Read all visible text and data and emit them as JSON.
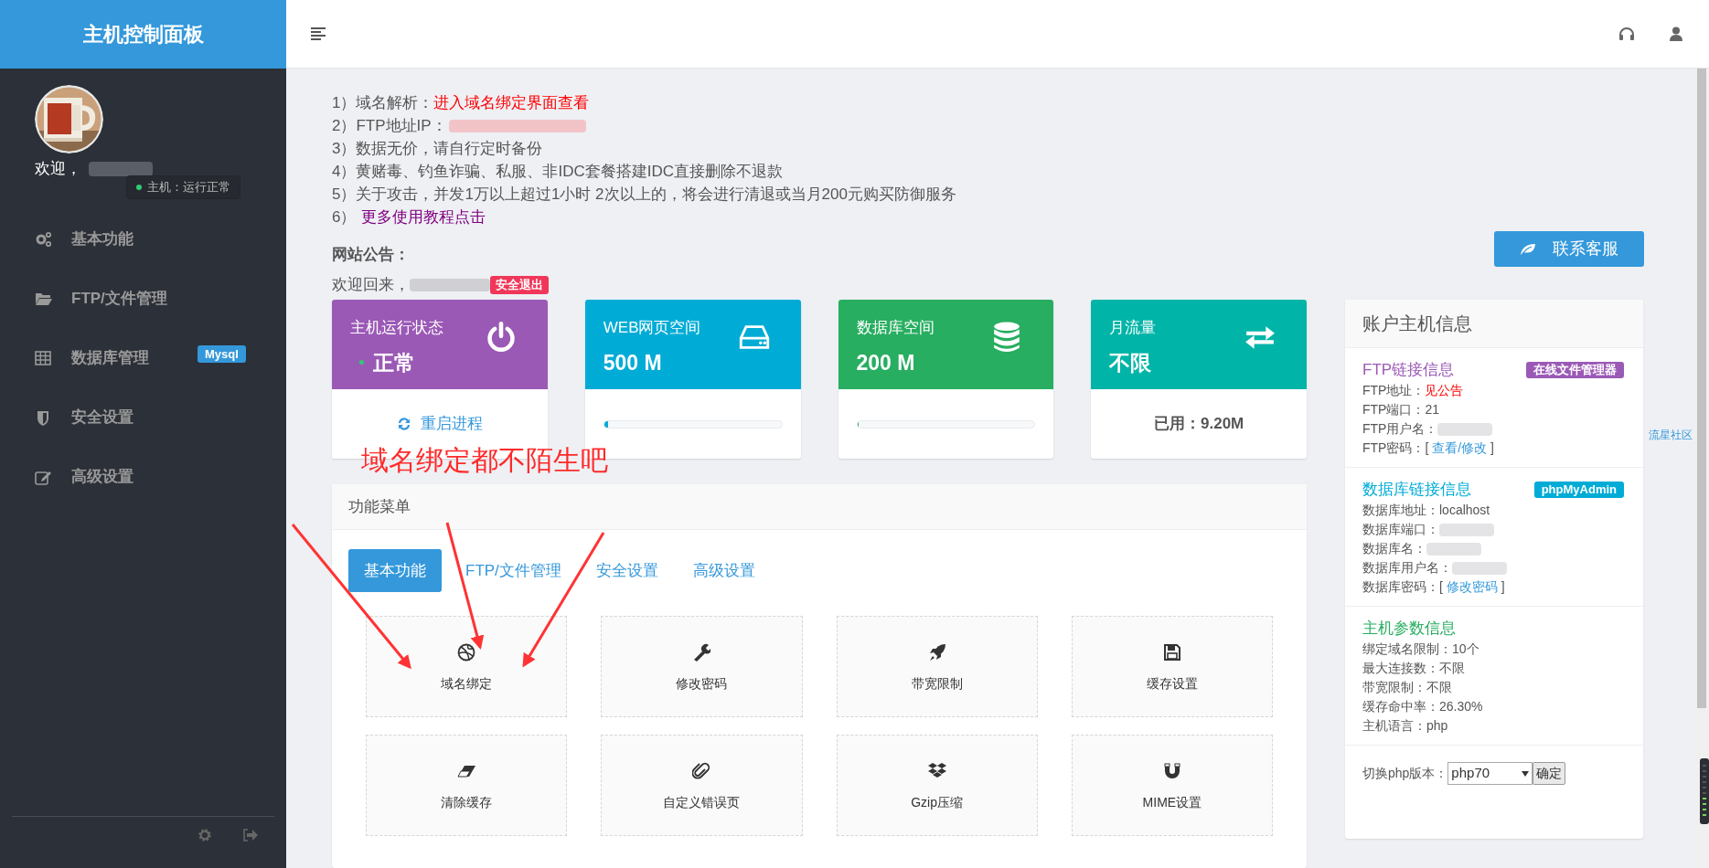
{
  "sidebar": {
    "title": "主机控制面板",
    "welcome": {
      "text": "欢迎，",
      "redacted": true
    },
    "status": "主机：运行正常",
    "menu": [
      {
        "label": "基本功能"
      },
      {
        "label": "FTP/文件管理"
      },
      {
        "label": "数据库管理",
        "badge": "Mysql"
      },
      {
        "label": "安全设置"
      },
      {
        "label": "高级设置"
      }
    ]
  },
  "notices": [
    {
      "text": "1）域名解析：",
      "link": {
        "text": "进入域名绑定界面查看",
        "kind": "alert"
      },
      "redacted": false
    },
    {
      "text": "2）FTP地址IP：",
      "redacted": true
    },
    {
      "text": "3）数据无价，请自行定时备份",
      "redacted": false
    },
    {
      "text": "4）黄赌毒、钓鱼诈骗、私服、非IDC套餐搭建IDC直接删除不退款",
      "redacted": false
    },
    {
      "text": "5）关于攻击，并发1万以上超过1小时 2次以上的，将会进行清退或当月200元购买防御服务",
      "redacted": false
    },
    {
      "text": "6）",
      "link": {
        "text": "更多使用教程点击",
        "kind": "visited"
      },
      "redacted": false
    }
  ],
  "announcement_label": "网站公告：",
  "contact_button": "联系客服",
  "welcome_back": {
    "text": "欢迎回来，",
    "redacted": true,
    "logout_badge": "安全退出"
  },
  "stat_cards": [
    {
      "title": "主机运行状态",
      "value": "正常",
      "color": "#9b59b6",
      "status_dot": true,
      "footer": {
        "kind": "action",
        "text": "重启进程"
      }
    },
    {
      "title": "WEB网页空间",
      "value": "500 M",
      "color": "#00acd6",
      "status_dot": false,
      "footer": {
        "kind": "progress",
        "level": 0.02
      }
    },
    {
      "title": "数据库空间",
      "value": "200 M",
      "color": "#27ae60",
      "status_dot": false,
      "footer": {
        "kind": "progress",
        "level": 0.005
      }
    },
    {
      "title": "月流量",
      "value": "不限",
      "color": "#00b5a7",
      "status_dot": false,
      "footer": {
        "kind": "text",
        "text": "已用：9.20M"
      }
    }
  ],
  "annotation": "域名绑定都不陌生吧",
  "function_menu": {
    "title": "功能菜单",
    "tabs": [
      {
        "label": "基本功能",
        "selected": true
      },
      {
        "label": "FTP/文件管理",
        "selected": false
      },
      {
        "label": "安全设置",
        "selected": false
      },
      {
        "label": "高级设置",
        "selected": false
      }
    ],
    "items": [
      {
        "label": "域名绑定"
      },
      {
        "label": "修改密码"
      },
      {
        "label": "带宽限制"
      },
      {
        "label": "缓存设置"
      },
      {
        "label": "清除缓存"
      },
      {
        "label": "自定义错误页"
      },
      {
        "label": "Gzip压缩"
      },
      {
        "label": "MIME设置"
      }
    ]
  },
  "account_panel": {
    "title": "账户主机信息",
    "sections": [
      {
        "title": "FTP链接信息",
        "color": "#9b59b6",
        "badge": "在线文件管理器",
        "rows": [
          {
            "label": "FTP地址：",
            "parts": [
              {
                "text": "见公告",
                "kind": "alert"
              }
            ],
            "redacted": false
          },
          {
            "label": "FTP端口：",
            "parts": [
              {
                "text": "21",
                "kind": "plain"
              }
            ],
            "redacted": false
          },
          {
            "label": "FTP用户名：",
            "redacted": true
          },
          {
            "label": "FTP密码：",
            "parts": [
              {
                "text": "[ ",
                "kind": "plain"
              },
              {
                "text": "查看/修改",
                "kind": "link"
              },
              {
                "text": " ]",
                "kind": "plain"
              }
            ],
            "redacted": false
          }
        ]
      },
      {
        "title": "数据库链接信息",
        "color": "#00acd6",
        "badge": "phpMyAdmin",
        "rows": [
          {
            "label": "数据库地址：",
            "parts": [
              {
                "text": "localhost",
                "kind": "plain"
              }
            ],
            "redacted": false
          },
          {
            "label": "数据库端口：",
            "redacted": true
          },
          {
            "label": "数据库名：",
            "redacted": true
          },
          {
            "label": "数据库用户名：",
            "redacted": true
          },
          {
            "label": "数据库密码：",
            "parts": [
              {
                "text": "[ ",
                "kind": "plain"
              },
              {
                "text": "修改密码",
                "kind": "link"
              },
              {
                "text": " ]",
                "kind": "plain"
              }
            ],
            "redacted": false
          }
        ]
      },
      {
        "title": "主机参数信息",
        "color": "#27ae60",
        "rows": [
          {
            "label": "绑定域名限制：",
            "parts": [
              {
                "text": "10个",
                "kind": "plain"
              }
            ],
            "redacted": false
          },
          {
            "label": "最大连接数：",
            "parts": [
              {
                "text": "不限",
                "kind": "plain"
              }
            ],
            "redacted": false
          },
          {
            "label": "带宽限制：",
            "parts": [
              {
                "text": "不限",
                "kind": "plain"
              }
            ],
            "redacted": false
          },
          {
            "label": "缓存命中率：",
            "parts": [
              {
                "text": "26.30%",
                "kind": "plain"
              }
            ],
            "redacted": false
          },
          {
            "label": "主机语言：",
            "parts": [
              {
                "text": "php",
                "kind": "plain"
              }
            ],
            "redacted": false
          }
        ]
      }
    ],
    "php_switch": {
      "label": "切换php版本：",
      "value": "php70",
      "button": "确定"
    }
  },
  "side_link": "流星社区"
}
